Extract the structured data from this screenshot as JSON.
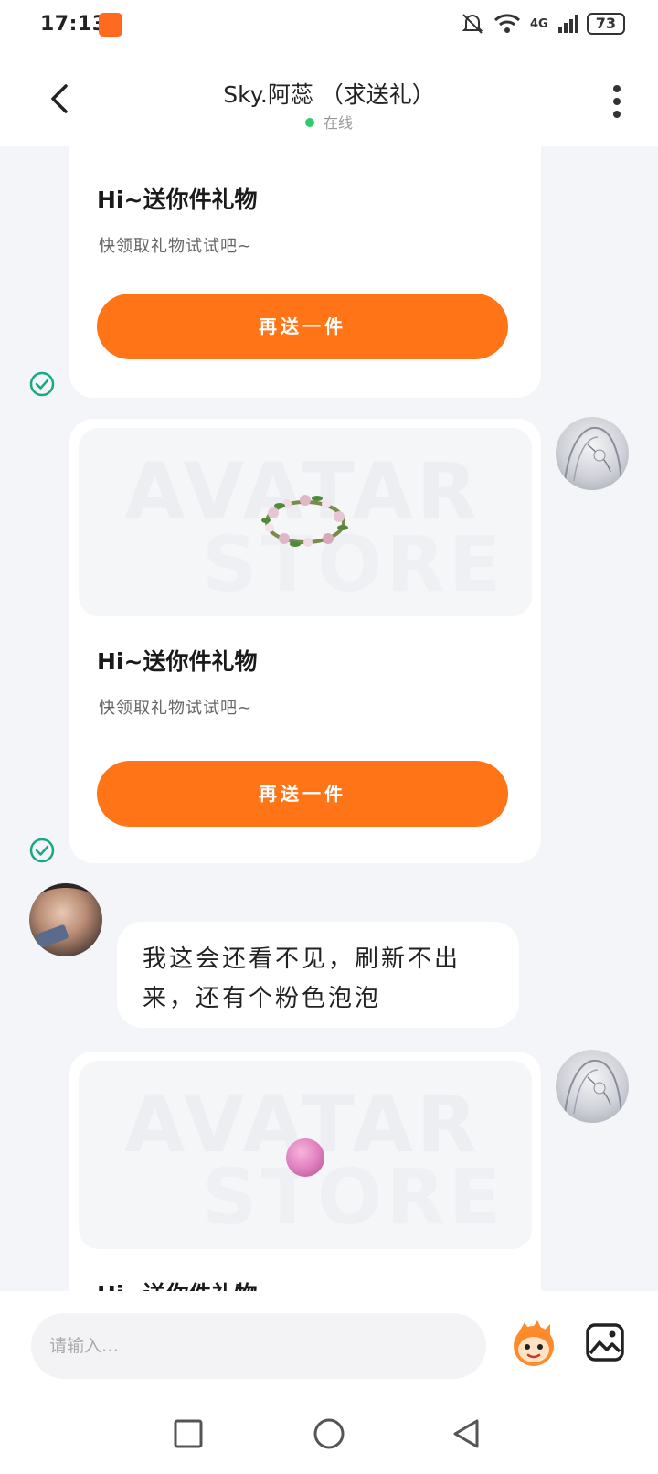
{
  "status": {
    "time": "17:13",
    "network": "4G",
    "battery": "73"
  },
  "header": {
    "title": "Sky.阿蕊 （求送礼）",
    "status": "在线"
  },
  "cards": [
    {
      "title": "Hi~送你件礼物",
      "subtitle": "快领取礼物试试吧~",
      "button": "再送一件"
    },
    {
      "title": "Hi~送你件礼物",
      "subtitle": "快领取礼物试试吧~",
      "button": "再送一件",
      "watermark_line1": "AVATAR",
      "watermark_line2": "STORE"
    },
    {
      "title": "Hi~送你件礼物",
      "watermark_line1": "AVATAR",
      "watermark_line2": "STORE"
    }
  ],
  "message": {
    "text": "我这会还看不见，刷新不出来，还有个粉色泡泡"
  },
  "input": {
    "placeholder": "请输入…"
  },
  "colors": {
    "accent": "#ff7417",
    "online": "#2ecc71",
    "check": "#1aa882"
  }
}
